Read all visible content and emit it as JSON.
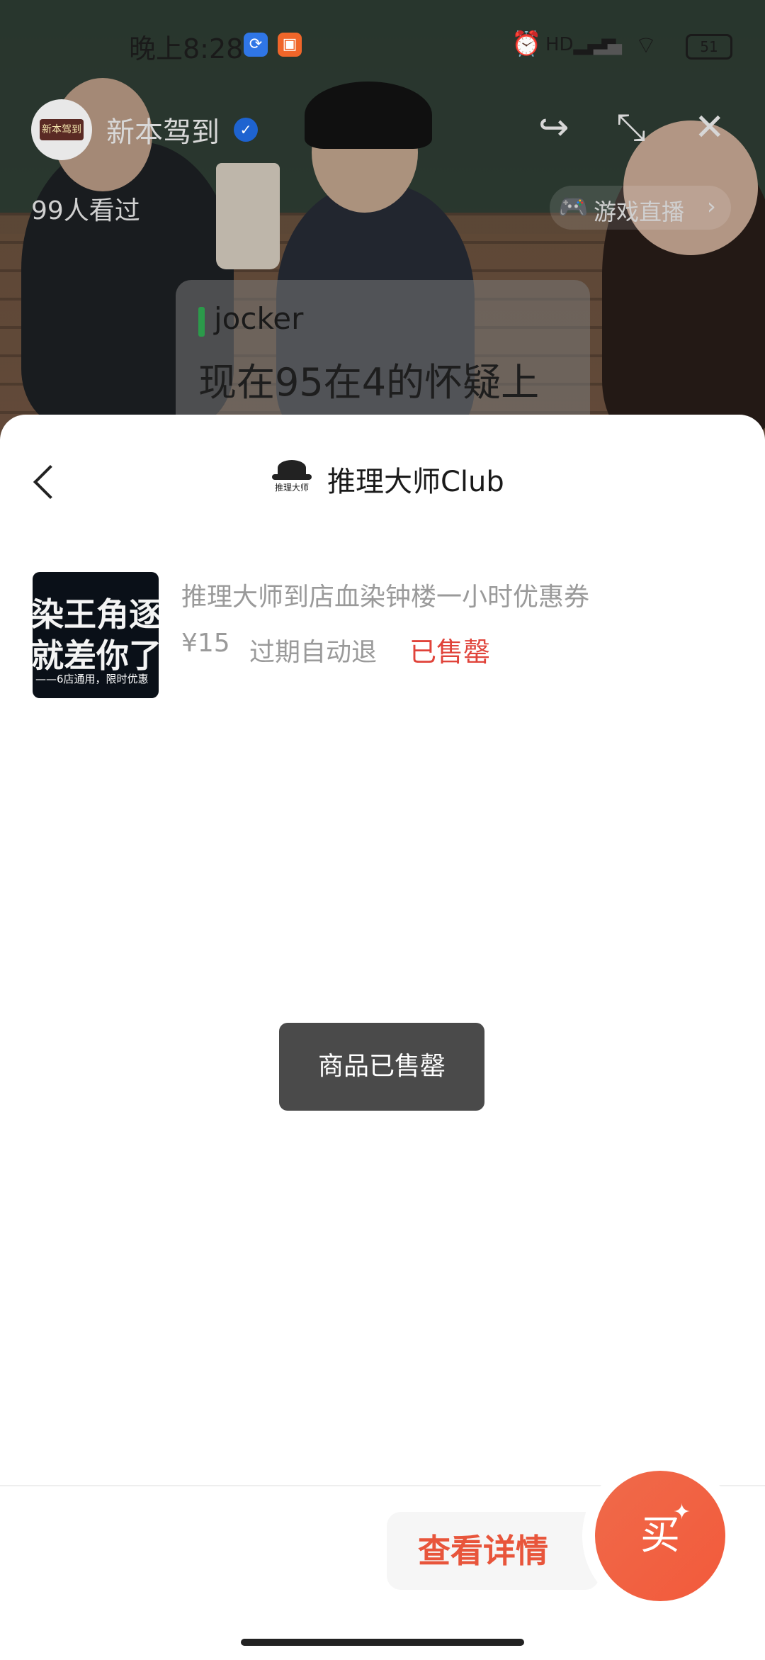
{
  "status_bar": {
    "time": "晚上8:28",
    "app_icon_1": "sync-app-icon",
    "app_icon_2": "orange-app-icon",
    "alarm": "⏰",
    "hd_signal": "HD▂▄▆",
    "signal2": "▂▄",
    "wifi": "⌔",
    "battery": "51"
  },
  "live": {
    "host_name": "新本驾到",
    "avatar_text": "新本驾到",
    "verified_icon": "✓",
    "viewers": "99人看过",
    "share_icon": "↪",
    "minimize_icon": "⤡",
    "close_icon": "✕",
    "game_live_label": "游戏直播",
    "game_icon": "🎮",
    "chevron": "›",
    "danmu": {
      "user": "jocker",
      "message": "现在95在4的怀疑上"
    }
  },
  "sheet": {
    "shop_name": "推理大师Club",
    "shop_logo_text": "推理大师",
    "product": {
      "thumb_line1": "染王角逐",
      "thumb_line2": "就差你了",
      "thumb_line3": "——6店通用，限时优惠",
      "title": "推理大师到店血染钟楼一小时优惠券",
      "price": "¥15",
      "refund": "过期自动退",
      "status": "已售罄"
    },
    "toast": "商品已售罄",
    "detail_button": "查看详情",
    "buy_button": "买",
    "buy_spark": "✦"
  }
}
